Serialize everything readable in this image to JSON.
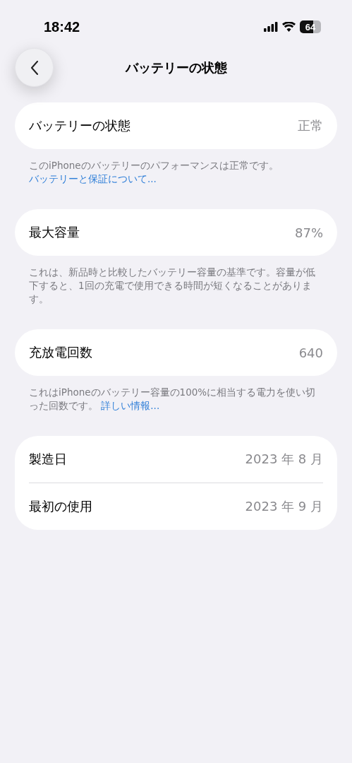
{
  "status_bar": {
    "time": "18:42",
    "battery": "64"
  },
  "nav": {
    "title": "バッテリーの状態"
  },
  "groups": [
    {
      "rows": [
        {
          "label": "バッテリーの状態",
          "value": "正常"
        }
      ],
      "footnote": {
        "text": "このiPhoneのバッテリーのパフォーマンスは正常です。",
        "link": "バッテリーと保証について..."
      }
    },
    {
      "rows": [
        {
          "label": "最大容量",
          "value": "87%"
        }
      ],
      "footnote": {
        "text": "これは、新品時と比較したバッテリー容量の基準です。容量が低下すると、1回の充電で使用できる時間が短くなることがあります。"
      }
    },
    {
      "rows": [
        {
          "label": "充放電回数",
          "value": "640"
        }
      ],
      "footnote": {
        "text": "これはiPhoneのバッテリー容量の100%に相当する電力を使い切った回数です。",
        "link": "詳しい情報..."
      }
    },
    {
      "rows": [
        {
          "label": "製造日",
          "value": "2023 年 8 月"
        },
        {
          "label": "最初の使用",
          "value": "2023 年 9 月"
        }
      ]
    }
  ]
}
